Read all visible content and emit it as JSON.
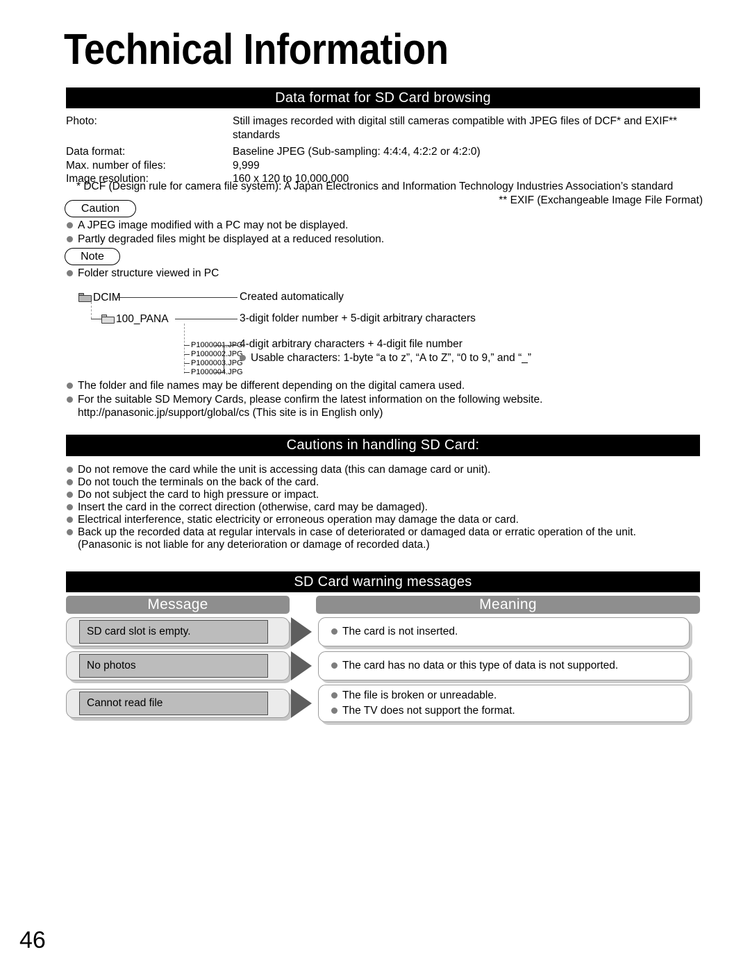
{
  "page": {
    "title": "Technical Information",
    "number": "46"
  },
  "sections": {
    "data_format": {
      "heading": "Data format for SD Card browsing",
      "rows": [
        {
          "label": "Photo:",
          "value": "Still images recorded with digital still cameras compatible with JPEG files of DCF* and EXIF** standards"
        },
        {
          "label": "Data format:",
          "value": "Baseline JPEG (Sub-sampling: 4:4:4, 4:2:2 or 4:2:0)"
        },
        {
          "label": "Max. number of files:",
          "value": "9,999"
        },
        {
          "label": "Image resolution:",
          "value": "160 x 120 to 10,000,000"
        }
      ],
      "footnote_1": "* DCF (Design rule for camera file system):  A Japan Electronics and Information Technology Industries Association’s standard",
      "footnote_2": "** EXIF (Exchangeable Image File Format)"
    },
    "caution": {
      "label": "Caution",
      "items": [
        "A JPEG image modified with a PC may not be displayed.",
        "Partly degraded files might be displayed at a reduced resolution."
      ]
    },
    "note": {
      "label": "Note",
      "intro": "Folder structure viewed in PC",
      "tree": {
        "root": {
          "name": "DCIM",
          "description": "Created automatically"
        },
        "subfolder": {
          "name": "100_PANA",
          "description": "3-digit folder number + 5-digit arbitrary characters"
        },
        "files": [
          "P1000001.JPG",
          "P1000002.JPG",
          "P1000003.JPG",
          "P1000004.JPG"
        ],
        "files_description": "4-digit arbitrary characters + 4-digit file number",
        "files_bullet": "Usable characters:  1-byte “a to z”, “A to Z”, “0 to 9,” and “_”"
      },
      "after_tree_items": [
        "The folder and file names may be different depending on the digital camera used.",
        "For the suitable SD Memory Cards, please confirm the latest information on the following website."
      ],
      "website_line": "http://panasonic.jp/support/global/cs (This site is in English only)"
    },
    "handling": {
      "heading": "Cautions in handling SD Card:",
      "items": [
        "Do not remove the card while the unit is accessing data (this can damage card or unit).",
        "Do not touch the terminals on the back of the card.",
        "Do not subject the card to high pressure or impact.",
        "Insert the card in the correct direction (otherwise, card may be damaged).",
        "Electrical interference, static electricity or erroneous operation may damage the data or card.",
        "Back up the recorded data at regular intervals in case of deteriorated or damaged data or erratic operation of the unit."
      ],
      "trailing_note": "(Panasonic is not liable for any deterioration or damage of recorded data.)"
    },
    "warnings": {
      "heading": "SD Card warning messages",
      "col_message": "Message",
      "col_meaning": "Meaning",
      "rows": [
        {
          "message": "SD card slot is empty.",
          "meanings": [
            "The card is not inserted."
          ]
        },
        {
          "message": "No photos",
          "meanings": [
            "The card has no data or this type of data is not supported."
          ]
        },
        {
          "message": "Cannot read file",
          "meanings": [
            "The file is broken or unreadable.",
            "The TV does not support the format."
          ]
        }
      ]
    }
  },
  "colors": {
    "bar_bg": "#000000",
    "bar_text": "#ffffff",
    "col_header_bg": "#8e8e8e",
    "bullet": "#7d7d7d",
    "arrow": "#5e5e5e",
    "msg_outer_bg": "#ebebeb",
    "msg_inner_bg": "#bcbcbc"
  }
}
